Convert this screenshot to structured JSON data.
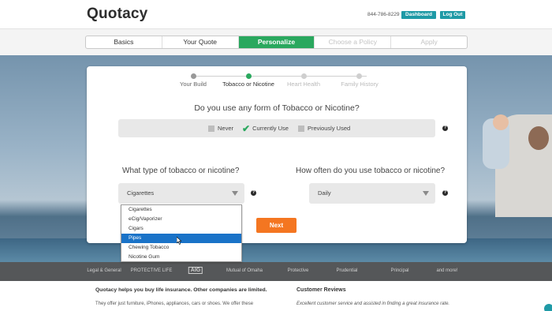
{
  "header": {
    "logo": "Quotacy",
    "phone": "844-786-8229",
    "dashboard_label": "Dashboard",
    "logout_label": "Log Out"
  },
  "progress": {
    "steps": [
      {
        "label": "Basics",
        "state": "done"
      },
      {
        "label": "Your Quote",
        "state": "done"
      },
      {
        "label": "Personalize",
        "state": "active"
      },
      {
        "label": "Choose a Policy",
        "state": "future"
      },
      {
        "label": "Apply",
        "state": "future"
      }
    ]
  },
  "substeps": [
    {
      "label": "Your Build",
      "state": "done"
    },
    {
      "label": "Tobacco or Nicotine",
      "state": "active"
    },
    {
      "label": "Heart Health",
      "state": "future"
    },
    {
      "label": "Family History",
      "state": "future"
    }
  ],
  "tobacco_question": {
    "text": "Do you use any form of Tobacco or Nicotine?",
    "options": [
      {
        "label": "Never",
        "checked": false
      },
      {
        "label": "Currently Use",
        "checked": true
      },
      {
        "label": "Previously Used",
        "checked": false
      }
    ]
  },
  "type_question": {
    "text": "What type of tobacco or nicotine?",
    "selected": "Cigarettes",
    "options": [
      "Cigarettes",
      "eCig/Vaporizer",
      "Cigars",
      "Pipes",
      "Chewing Tobacco",
      "Nicotine Gum"
    ],
    "highlighted": "Pipes"
  },
  "frequency_question": {
    "text": "How often do you use tobacco or nicotine?",
    "selected": "Daily"
  },
  "next_label": "Next",
  "help_glyph": "?",
  "partners": [
    "Legal & General",
    "PROTECTIVE LIFE",
    "AIG",
    "Mutual of Omaha",
    "Protective",
    "Prudential",
    "Principal",
    "and more!"
  ],
  "footer": {
    "left_title": "Quotacy helps you buy life insurance. Other companies are limited.",
    "left_text": "They offer just furniture, iPhones, appliances, cars or shoes. We offer these",
    "right_title": "Customer Reviews",
    "right_text": "Excellent customer service and assisted in finding a great insurance rate."
  },
  "colors": {
    "accent_green": "#2aa85e",
    "teal": "#1f9aa6",
    "orange": "#f47621",
    "select_blue": "#1a73c8"
  }
}
